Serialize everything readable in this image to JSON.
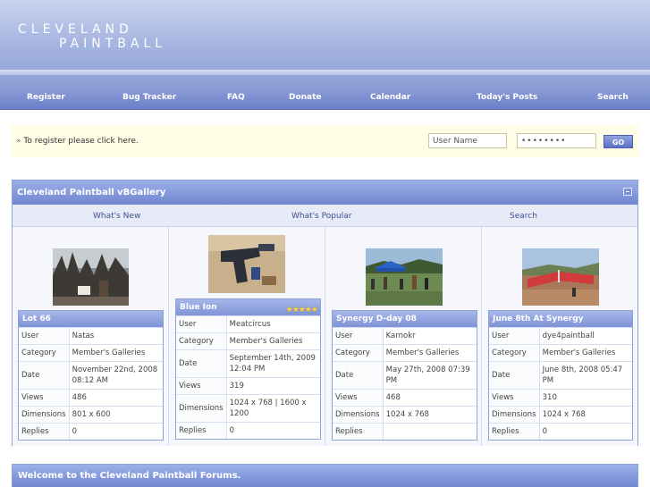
{
  "header": {
    "logo_line1": "CLEVELAND",
    "logo_line2": "PAINTBALL"
  },
  "nav": [
    "Register",
    "Bug Tracker",
    "FAQ",
    "Donate",
    "Calendar",
    "Today's Posts",
    "Search"
  ],
  "register": {
    "text": "To register please click here.",
    "username_placeholder": "User Name",
    "password_value": "••••••••",
    "go_label": "GO"
  },
  "gallery": {
    "title": "Cleveland Paintball vBGallery",
    "links": [
      "What's New",
      "What's Popular",
      "Search"
    ],
    "labels": {
      "user": "User",
      "category": "Category",
      "date": "Date",
      "views": "Views",
      "dimensions": "Dimensions",
      "replies": "Replies"
    },
    "items": [
      {
        "title": "Lot 66",
        "user": "Natas",
        "category": "Member's Galleries",
        "date": "November 22nd, 2008 08:12 AM",
        "views": "486",
        "dimensions": "801 x 600",
        "replies": "0",
        "rating": 0
      },
      {
        "title": "Blue Ion",
        "user": "Meatcircus",
        "category": "Member's Galleries",
        "date": "September 14th, 2009 12:04 PM",
        "views": "319",
        "dimensions": "1024 x 768 | 1600 x 1200",
        "replies": "0",
        "rating": 5
      },
      {
        "title": "Synergy D-day 08",
        "user": "Karnokr",
        "category": "Member's Galleries",
        "date": "May 27th, 2008 07:39 PM",
        "views": "468",
        "dimensions": "1024 x 768",
        "replies": "",
        "rating": 0
      },
      {
        "title": "June 8th At Synergy",
        "user": "dye4paintball",
        "category": "Member's Galleries",
        "date": "June 8th, 2008 05:47 PM",
        "views": "310",
        "dimensions": "1024 x 768",
        "replies": "0",
        "rating": 0
      }
    ]
  },
  "welcome": {
    "title": "Welcome to the Cleveland Paintball Forums."
  },
  "colors": {
    "accent": "#7086d0",
    "header": "#a9b8e2",
    "register_bg": "#fffde6"
  }
}
